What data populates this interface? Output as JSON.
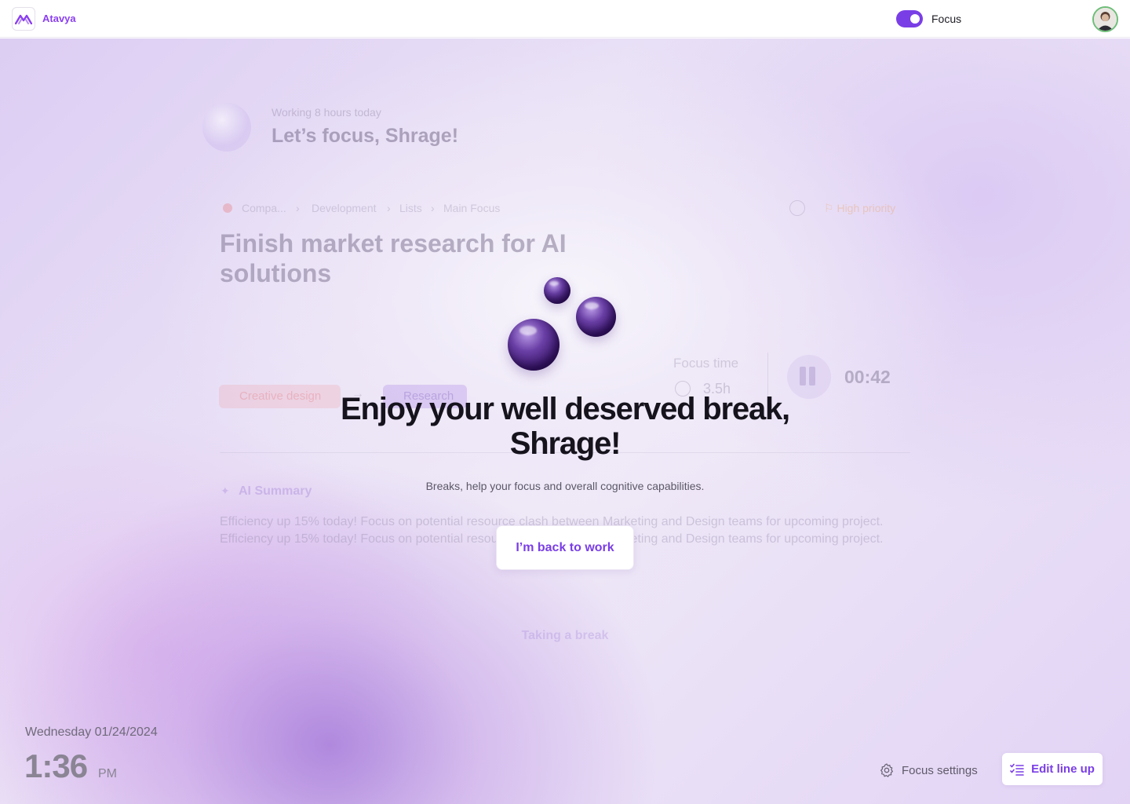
{
  "app": {
    "brand": "Atavya",
    "focus_toggle": {
      "label": "Focus",
      "on": true,
      "color": "#7a3ee6"
    },
    "avatar_icon": "user-avatar"
  },
  "background": {
    "subtitle": "Working 8 hours today",
    "greeting": "Let’s focus, Shrage!",
    "breadcrumb": [
      "Compa...",
      "Development",
      "Lists",
      "Main Focus"
    ],
    "priority": "High priority",
    "task_title": "Finish market research for AI solutions",
    "chips": [
      "Creative design",
      "Research"
    ],
    "focus_time_label": "Focus time",
    "focus_time_value": "3.5h",
    "timer": "00:42",
    "ai_summary_title": "AI Summary",
    "ai_summary_text": "Efficiency up 15% today! Focus on potential resource clash between Marketing and Design teams for upcoming project. Efficiency up 15% today! Focus on potential resource clash between Marketing and Design teams for upcoming project.",
    "status": "Taking a break"
  },
  "modal": {
    "headline": "Enjoy your well deserved break, Shrage!",
    "subline": "Breaks, help your focus and overall cognitive capabilities.",
    "button": "I’m back to work"
  },
  "footer": {
    "date": "Wednesday 01/24/2024",
    "time": "1:36",
    "ampm": "PM",
    "settings_label": "Focus settings",
    "edit_label": "Edit line up"
  },
  "colors": {
    "accent": "#7a3ee6",
    "headline": "#16131d"
  }
}
